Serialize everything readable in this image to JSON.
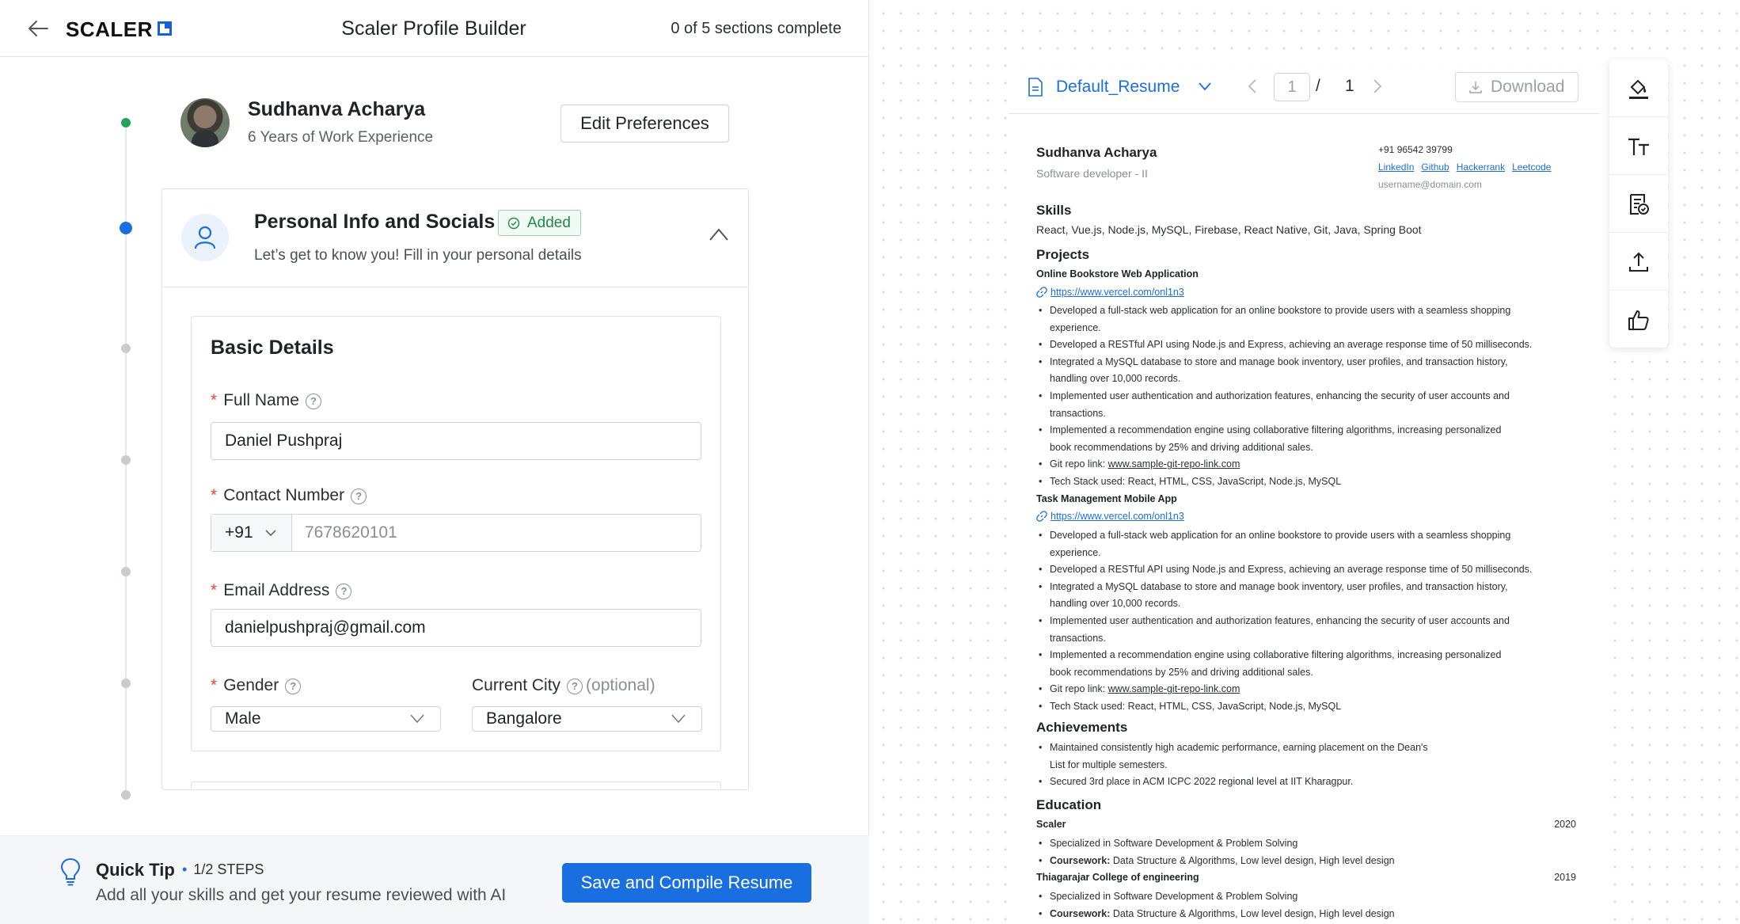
{
  "header": {
    "logo": "SCALER",
    "title": "Scaler Profile Builder",
    "progress": "0 of 5 sections complete"
  },
  "profile": {
    "name": "Sudhanva Acharya",
    "experience": "6 Years of Work Experience",
    "edit_button": "Edit Preferences"
  },
  "section": {
    "title": "Personal Info and Socials",
    "badge": "Added",
    "subtitle": "Let’s get to know you! Fill in your personal details"
  },
  "basic_details": {
    "title": "Basic Details",
    "full_name_label": "Full Name",
    "full_name_value": "Daniel Pushpraj",
    "contact_label": "Contact Number",
    "country_code": "+91",
    "contact_placeholder": "7678620101",
    "email_label": "Email Address",
    "email_value": "danielpushpraj@gmail.com",
    "gender_label": "Gender",
    "gender_value": "Male",
    "city_label": "Current City",
    "city_optional": "(optional)",
    "city_value": "Bangalore"
  },
  "footer": {
    "tip_title": "Quick Tip",
    "tip_steps": "1/2 STEPS",
    "tip_text": "Add all your skills and get your resume reviewed with AI",
    "save_button": "Save and Compile Resume"
  },
  "viewer": {
    "file_name": "Default_Resume",
    "current_page": "1",
    "separator": "/",
    "total_pages": "1",
    "download": "Download"
  },
  "resume": {
    "name": "Sudhanva Acharya",
    "role": "Software developer - II",
    "phone": "+91 96542 39799",
    "links": [
      "LinkedIn",
      "Github",
      "Hackerrank",
      "Leetcode"
    ],
    "email": "username@domain.com",
    "skills_heading": "Skills",
    "skills": "React, Vue.js, Node.js, MySQL, Firebase, React Native, Git, Java, Spring Boot",
    "projects_heading": "Projects",
    "projects": [
      {
        "title": "Online Bookstore Web Application",
        "url": "https://www.vercel.com/onl1n3",
        "bullets": [
          "Developed a full-stack web application for an online bookstore to provide users with a seamless shopping",
          "experience.",
          "Developed a RESTful API using Node.js and Express, achieving an average response time of 50 milliseconds.",
          "Integrated a MySQL database to store and manage book inventory, user profiles, and transaction history,",
          "handling over 10,000 records.",
          "Implemented user authentication and authorization features, enhancing the security of user accounts and",
          "transactions.",
          "Implemented a recommendation engine using collaborative filtering algorithms, increasing personalized",
          "book recommendations by 25% and driving additional sales."
        ],
        "repo_prefix": "Git repo link: ",
        "repo": "www.sample-git-repo-link.com",
        "stack": "Tech Stack used: React, HTML, CSS, JavaScript, Node.js, MySQL"
      },
      {
        "title": "Task Management Mobile App",
        "url": "https://www.vercel.com/onl1n3",
        "bullets": [
          "Developed a full-stack web application for an online bookstore to provide users with a seamless shopping",
          "experience.",
          "Developed a RESTful API using Node.js and Express, achieving an average response time of 50 milliseconds.",
          "Integrated a MySQL database to store and manage book inventory, user profiles, and transaction history,",
          "handling over 10,000 records.",
          "Implemented user authentication and authorization features, enhancing the security of user accounts and",
          "transactions.",
          "Implemented a recommendation engine using collaborative filtering algorithms, increasing personalized",
          "book recommendations by 25% and driving additional sales."
        ],
        "repo_prefix": "Git repo link: ",
        "repo": "www.sample-git-repo-link.com",
        "stack": "Tech Stack used: React, HTML, CSS, JavaScript, Node.js, MySQL"
      }
    ],
    "achievements_heading": "Achievements",
    "achievements": [
      "Maintained consistently high academic performance, earning placement on the Dean's",
      "List for multiple semesters.",
      "Secured 3rd place in ACM ICPC 2022 regional level at IIT Kharagpur."
    ],
    "education_heading": "Education",
    "education": [
      {
        "school": "Scaler",
        "year": "2020",
        "line1": "Specialized in Software Development & Problem Solving",
        "coursework_label": "Coursework:",
        "coursework": " Data Structure & Algorithms, Low level design, High level design"
      },
      {
        "school": "Thiagarajar College of engineering",
        "year": "2019",
        "line1": "Specialized in Software Development & Problem Solving",
        "coursework_label": "Coursework:",
        "coursework": " Data Structure & Algorithms, Low level design, High level design"
      }
    ]
  },
  "toolbar_icons": [
    "paint-bucket-icon",
    "text-size-icon",
    "resume-check-icon",
    "upload-icon",
    "thumbs-up-icon"
  ],
  "colors": {
    "accent": "#1a6fe0",
    "success": "#22a55a",
    "required": "#e0453a"
  }
}
